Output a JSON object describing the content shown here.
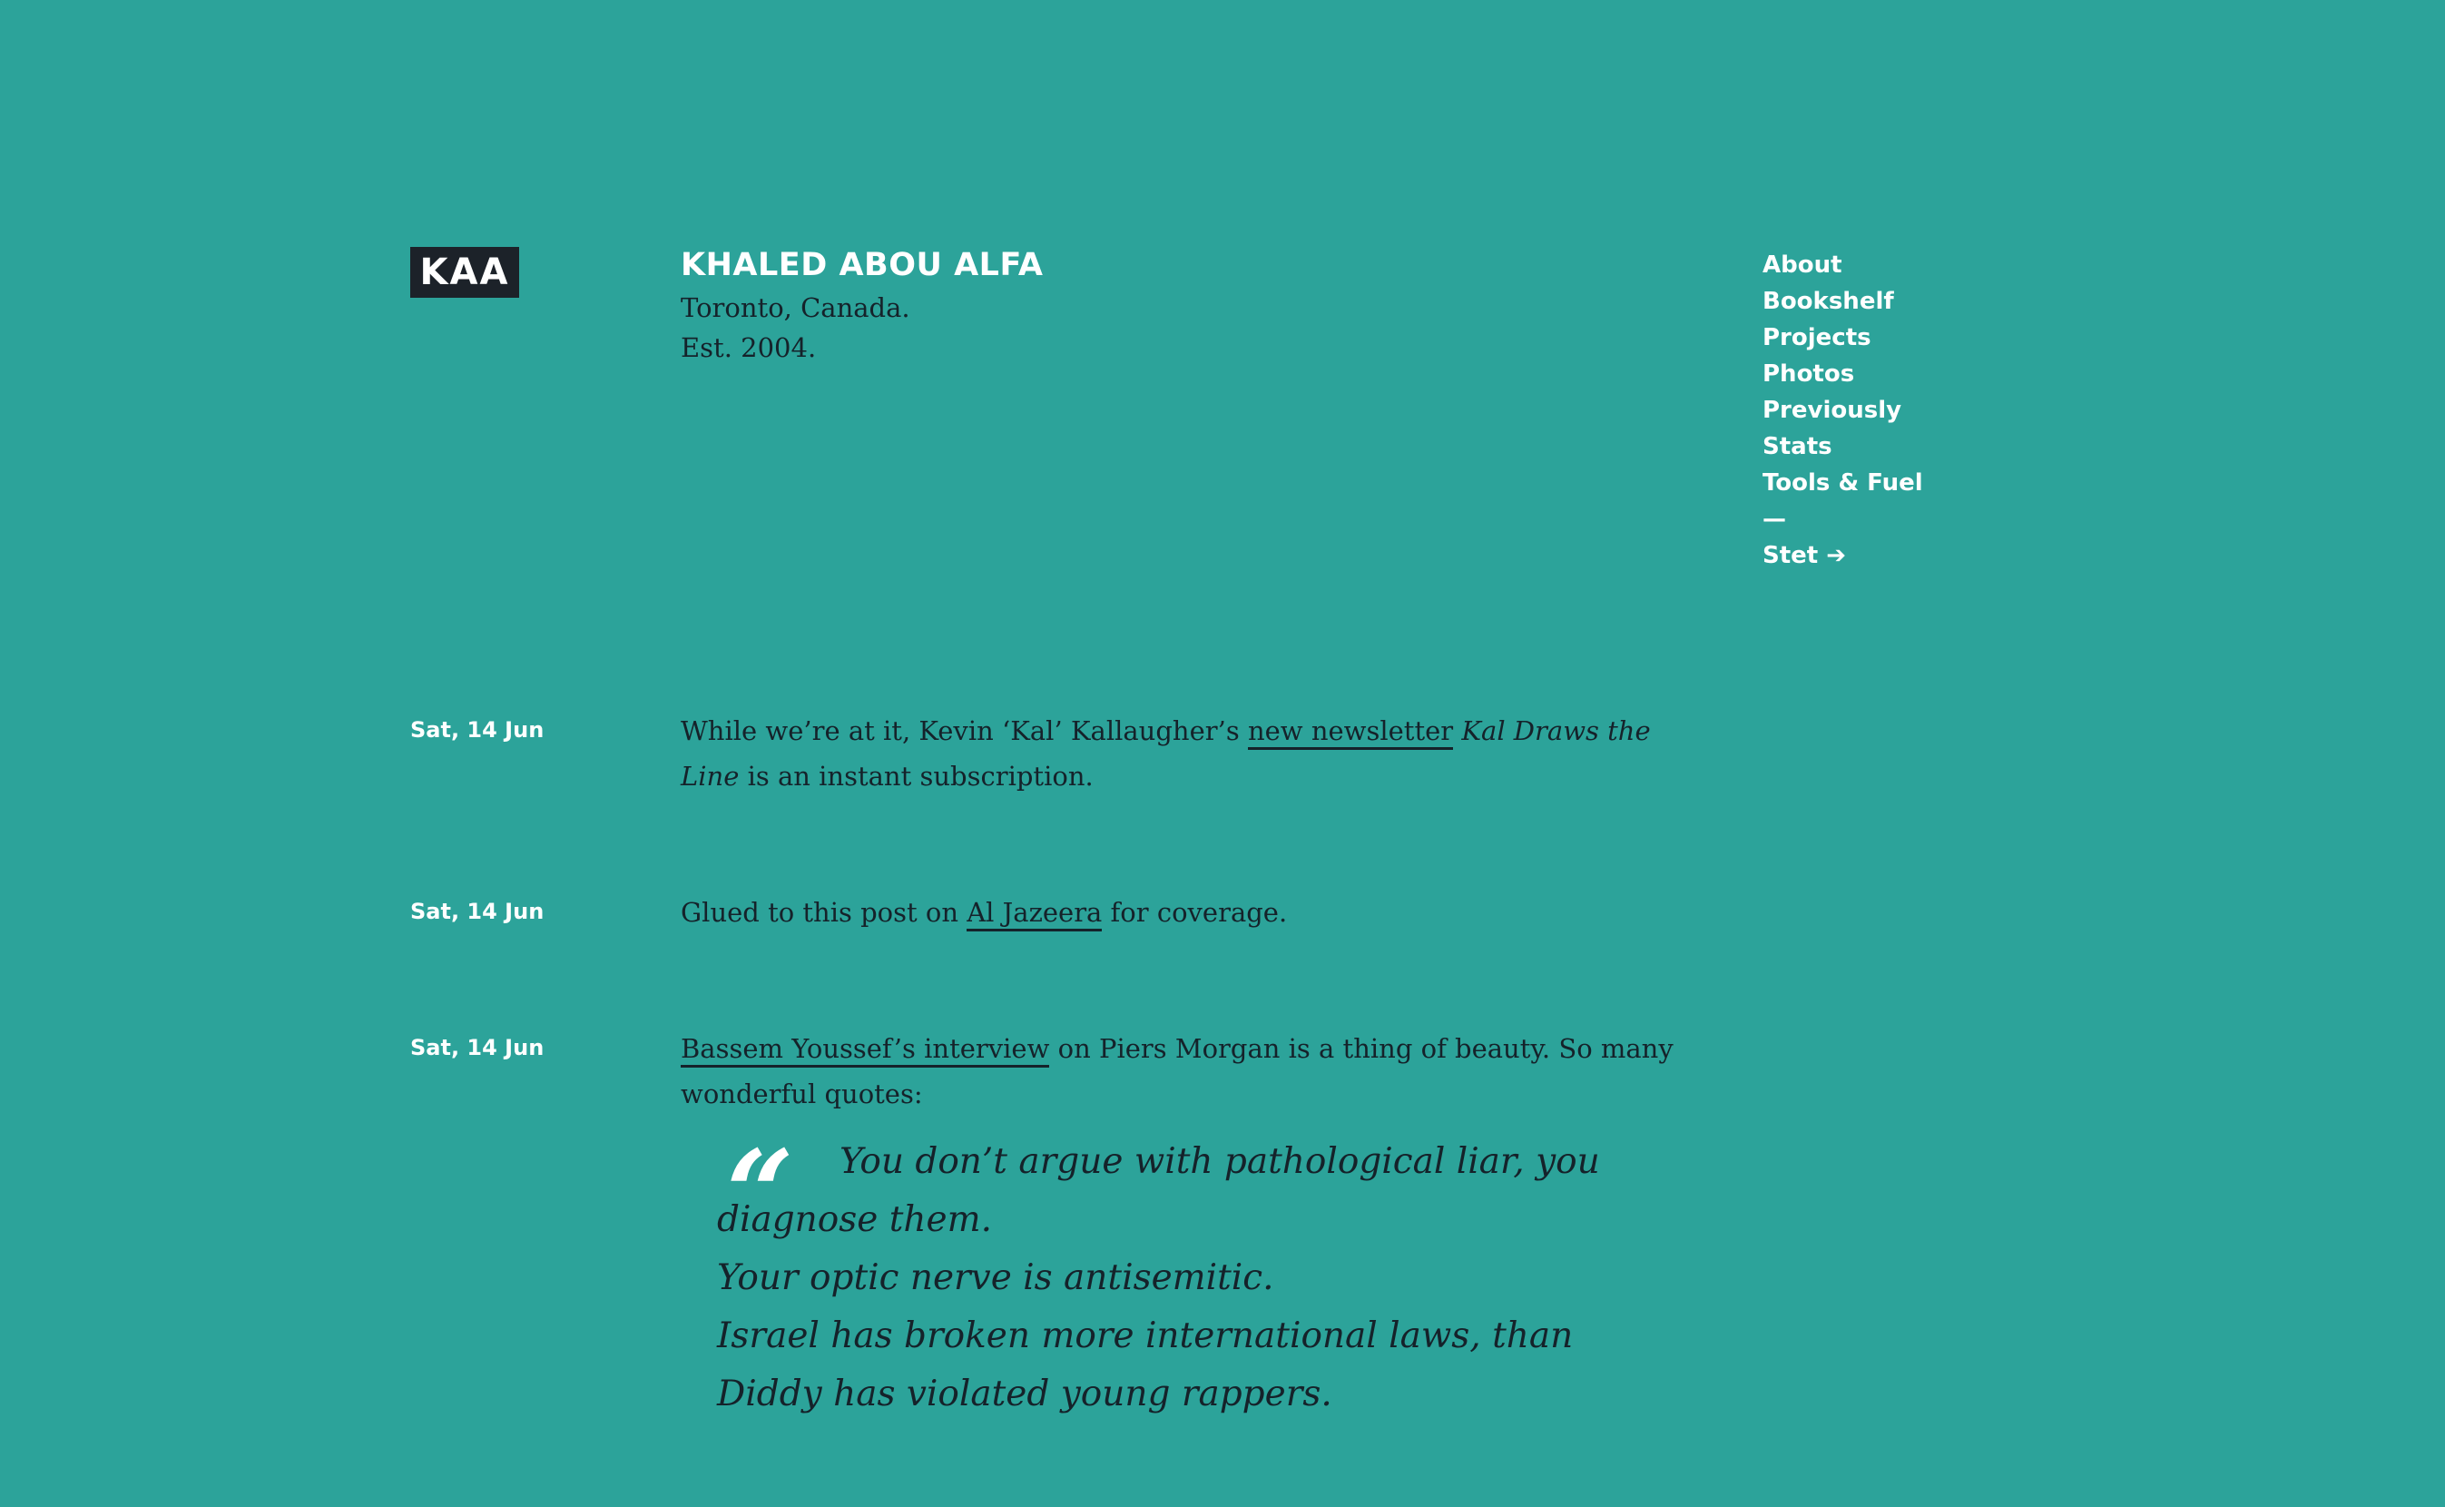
{
  "header": {
    "logo": "KAA",
    "site_name": "KHALED ABOU ALFA",
    "location": "Toronto, Canada.",
    "established": "Est. 2004."
  },
  "nav": {
    "items": [
      {
        "label": "About"
      },
      {
        "label": "Bookshelf"
      },
      {
        "label": "Projects"
      },
      {
        "label": "Photos"
      },
      {
        "label": "Previously"
      },
      {
        "label": "Stats"
      },
      {
        "label": "Tools & Fuel"
      }
    ],
    "separator": "—",
    "stet": "Stet ➔"
  },
  "posts": [
    {
      "date": "Sat, 14 Jun",
      "text_before": "While we’re at it, Kevin ‘Kal’ Kallaugher’s ",
      "link": "new newsletter",
      "italic": "Kal Draws the Line",
      "text_after": " is an instant subscription."
    },
    {
      "date": "Sat, 14 Jun",
      "text_before": "Glued to this post on ",
      "link": "Al Jazeera",
      "text_after": " for coverage."
    },
    {
      "date": "Sat, 14 Jun",
      "link": "Bassem Youssef’s interview",
      "text_after": " on Piers Morgan is a thing of beauty. So many wonderful quotes:",
      "quote_mark": "“",
      "quote_lines": [
        "You don’t argue with pathological liar, you diagnose them.",
        "Your optic nerve is antisemitic.",
        "Israel has broken more international laws, than Diddy has violated young rappers."
      ]
    }
  ]
}
